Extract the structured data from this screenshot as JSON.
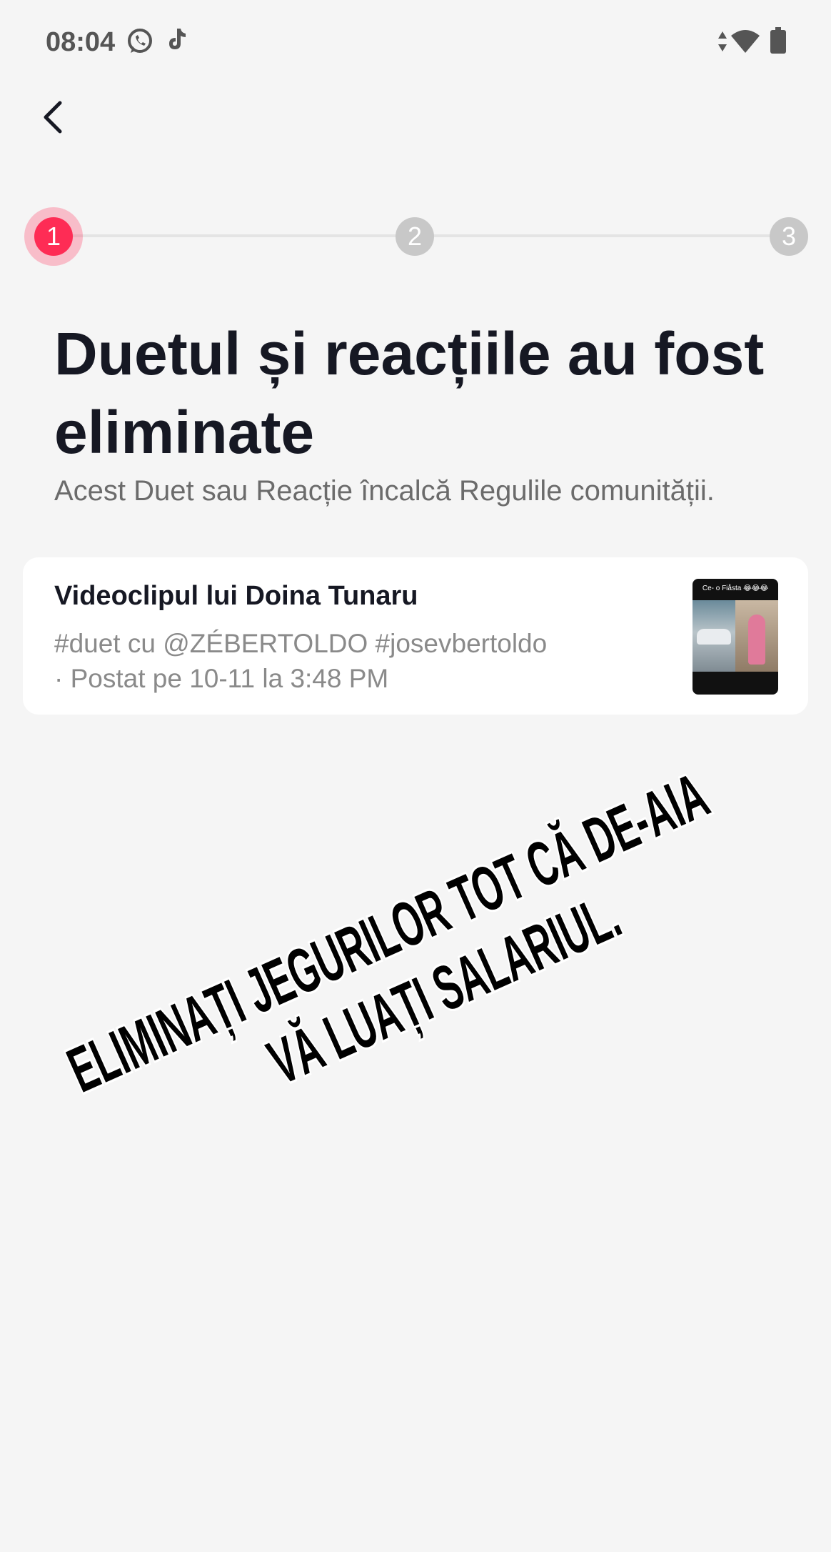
{
  "status_bar": {
    "time": "08:04",
    "left_icons": [
      "whatsapp-icon",
      "tiktok-icon"
    ],
    "right_icons": [
      "data-arrows-icon",
      "wifi-icon",
      "battery-icon"
    ]
  },
  "nav": {
    "back_icon": "chevron-left-icon"
  },
  "stepper": {
    "steps": [
      "1",
      "2",
      "3"
    ],
    "active_step": 1
  },
  "content": {
    "title": "Duetul și reacțiile au fost eliminate",
    "subtitle": "Acest Duet sau Reacție încalcă Regulile comunității."
  },
  "video_card": {
    "title": "Videoclipul lui Doina Tunaru",
    "description": "#duet cu @ZÉBERTOLDO #josevbertoldo",
    "posted": "· Postat pe 10-11 la 3:48 PM",
    "thumbnail_caption": "Ce- o Fiåsta 😂😂😂"
  },
  "overlay_text": {
    "line1": "ELIMINAȚI JEGURILOR TOT CĂ DE-AIA",
    "line2": "VĂ LUAȚI SALARIUL."
  },
  "colors": {
    "accent": "#fe2c55",
    "background": "#f5f5f5",
    "card": "#ffffff",
    "inactive_step": "#c8c8c8"
  }
}
